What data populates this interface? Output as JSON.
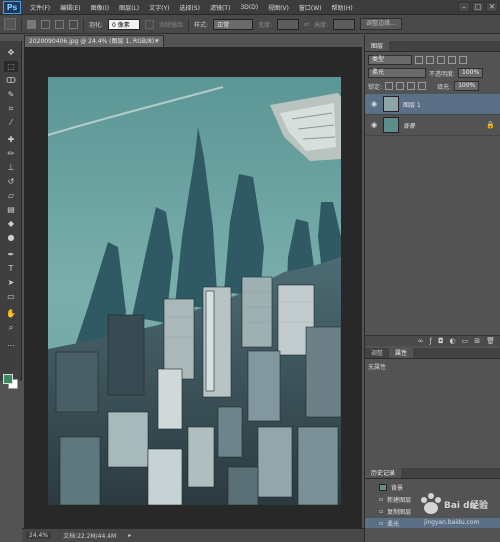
{
  "app": {
    "logo": "Ps"
  },
  "menu": [
    "文件(F)",
    "编辑(E)",
    "图像(I)",
    "图层(L)",
    "文字(Y)",
    "选择(S)",
    "滤镜(T)",
    "3D(D)",
    "视图(V)",
    "窗口(W)",
    "帮助(H)"
  ],
  "window_buttons": {
    "minimize": "–",
    "maximize": "□",
    "close": "✕"
  },
  "options": {
    "feather_label": "羽化:",
    "feather_value": "0 像素",
    "antialias_label": "消除锯齿",
    "style_label": "样式:",
    "style_value": "正常",
    "width_label": "宽度:",
    "height_label": "高度:",
    "refine_edge": "调整边缘..."
  },
  "document": {
    "tab_title": "2020090406.jpg @ 24.4% (图层 1, RGB/8) *",
    "tab_close": "×"
  },
  "status": {
    "zoom": "24.4%",
    "doc_size": "文档:22.2M/44.4M"
  },
  "layers_panel": {
    "tab": "图层",
    "kind_value": "类型",
    "blend_mode": "柔光",
    "opacity_label": "不透明度:",
    "opacity_value": "100%",
    "lock_label": "锁定:",
    "fill_label": "填充:",
    "fill_value": "100%",
    "layers": [
      {
        "name": "图层 1",
        "selected": true
      },
      {
        "name": "背景",
        "selected": false,
        "locked": true
      }
    ]
  },
  "properties_panel": {
    "tabs": [
      "调整",
      "属性"
    ],
    "active_tab": "属性",
    "content": "无属性"
  },
  "history_panel": {
    "tab": "历史记录",
    "items": [
      "背景",
      "新建图层",
      "复制图层",
      "柔光"
    ]
  },
  "watermark": {
    "text": "Baidu经验",
    "url": "jingyan.baidu.com"
  },
  "colors": {
    "foreground": "#3c8a5c",
    "background": "#ffffff",
    "selection": "#5b6f86",
    "water": "#6a9f9e",
    "shadow": "#2f5a64"
  },
  "icons": [
    "move-icon",
    "marquee-icon",
    "lasso-icon",
    "quick-select-icon",
    "crop-icon",
    "eyedropper-icon",
    "healing-icon",
    "brush-icon",
    "stamp-icon",
    "history-brush-icon",
    "eraser-icon",
    "gradient-icon",
    "blur-icon",
    "dodge-icon",
    "pen-icon",
    "type-icon",
    "path-select-icon",
    "shape-icon",
    "hand-icon",
    "zoom-icon"
  ]
}
